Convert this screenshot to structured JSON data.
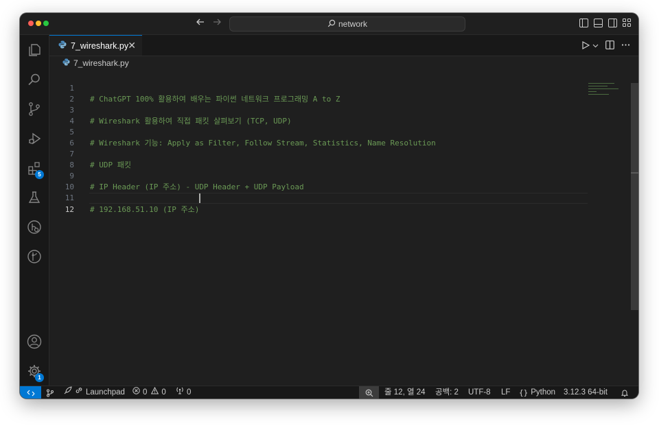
{
  "titlebar": {
    "search_text": "network"
  },
  "activity": {
    "extensions_badge": "5",
    "settings_badge": "1"
  },
  "tab": {
    "label": "7_wireshark.py",
    "close": "✕"
  },
  "breadcrumb": {
    "file": "7_wireshark.py"
  },
  "editor": {
    "line_numbers": [
      "1",
      "2",
      "3",
      "4",
      "5",
      "6",
      "7",
      "8",
      "9",
      "10",
      "11",
      "12"
    ],
    "lines": [
      "",
      "# ChatGPT 100% 활용하여 배우는 파이썬 네트워크 프로그래밍 A to Z",
      "",
      "# Wireshark 활용하여 직접 패킷 살펴보기 (TCP, UDP)",
      "",
      "# Wireshark 기능: Apply as Filter, Follow Stream, Statistics, Name Resolution",
      "",
      "# UDP 패킷",
      "",
      "# IP Header (IP 주소) - UDP Header + UDP Payload",
      "",
      "# 192.168.51.10 (IP 주소)"
    ],
    "active_line": "12"
  },
  "statusbar": {
    "launchpad": "Launchpad",
    "errors": "0",
    "warnings": "0",
    "ports": "0",
    "position": "줄 12, 열 24",
    "spaces": "공백: 2",
    "encoding": "UTF-8",
    "eol": "LF",
    "language": "Python",
    "interpreter": "3.12.3 64-bit"
  },
  "colors": {
    "accent": "#0078d4",
    "comment": "#6a9955",
    "background": "#1f1f1f"
  },
  "icons": [
    "explorer-icon",
    "search-icon",
    "source-control-icon",
    "run-debug-icon",
    "extensions-icon",
    "testing-icon",
    "remote-explorer-icon",
    "git-graph-icon",
    "account-icon",
    "settings-gear-icon",
    "python-file-icon",
    "run-icon",
    "split-editor-icon",
    "more-icon",
    "bell-icon",
    "zoom-icon"
  ]
}
